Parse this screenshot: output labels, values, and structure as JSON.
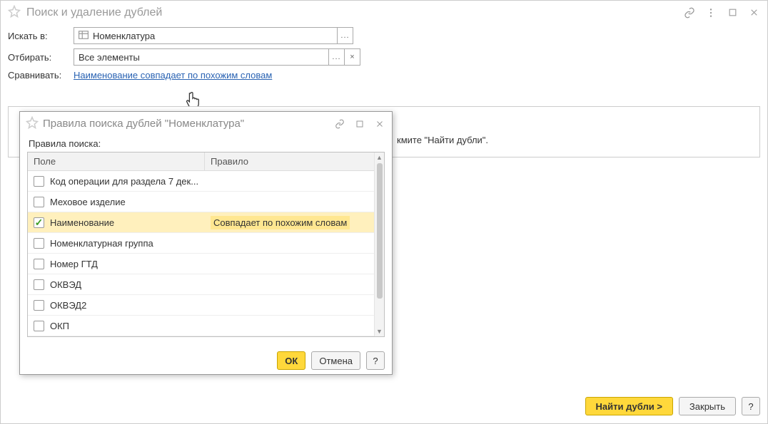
{
  "main": {
    "title": "Поиск и удаление дублей",
    "search_in_label": "Искать в:",
    "search_in_value": "Номенклатура",
    "filter_label": "Отбирать:",
    "filter_value": "Все элементы",
    "compare_label": "Сравнивать:",
    "compare_link": "Наименование совпадает по похожим словам",
    "hint": "кмите \"Найти дубли\"."
  },
  "modal": {
    "title": "Правила поиска дублей \"Номенклатура\"",
    "rules_label": "Правила поиска:",
    "columns": {
      "field": "Поле",
      "rule": "Правило"
    },
    "rows": [
      {
        "field": "Код операции для раздела 7 дек...",
        "rule": "",
        "checked": false
      },
      {
        "field": "Меховое изделие",
        "rule": "",
        "checked": false
      },
      {
        "field": "Наименование",
        "rule": "Совпадает по похожим словам",
        "checked": true,
        "selected": true
      },
      {
        "field": "Номенклатурная группа",
        "rule": "",
        "checked": false
      },
      {
        "field": "Номер ГТД",
        "rule": "",
        "checked": false
      },
      {
        "field": "ОКВЭД",
        "rule": "",
        "checked": false
      },
      {
        "field": "ОКВЭД2",
        "rule": "",
        "checked": false
      },
      {
        "field": "ОКП",
        "rule": "",
        "checked": false
      }
    ],
    "buttons": {
      "ok": "ОК",
      "cancel": "Отмена",
      "help": "?"
    }
  },
  "bottom": {
    "find_dupes": "Найти дубли >",
    "close": "Закрыть",
    "help": "?"
  }
}
